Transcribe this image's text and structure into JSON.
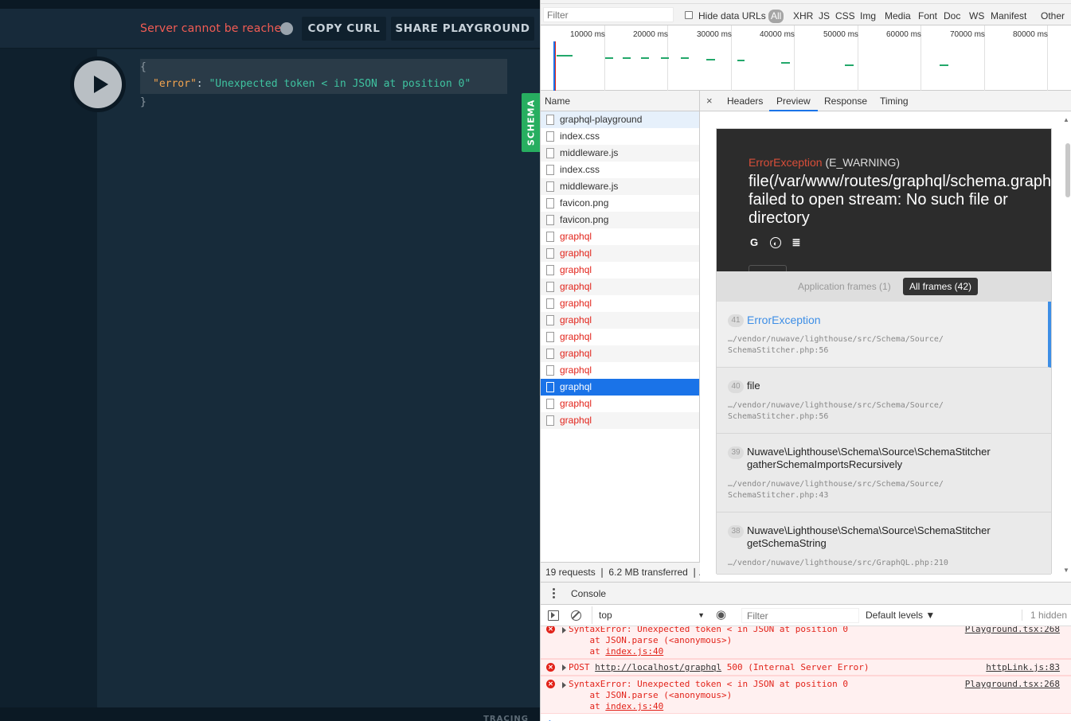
{
  "playground": {
    "status_text": "Server cannot be reached",
    "copy_curl": "COPY CURL",
    "share_playground": "SHARE PLAYGROUND",
    "schema_tab": "SCHEMA",
    "tracing": "TRACING",
    "result": {
      "open_brace": "{",
      "key": "\"error\"",
      "colon": ": ",
      "value": "\"Unexpected token < in JSON at position 0\"",
      "close_brace": "}"
    }
  },
  "network": {
    "filter_placeholder": "Filter",
    "hide_data_urls": "Hide data URLs",
    "filter_types": [
      "All",
      "XHR",
      "JS",
      "CSS",
      "Img",
      "Media",
      "Font",
      "Doc",
      "WS",
      "Manifest",
      "Other"
    ],
    "timeline_labels": [
      "10000 ms",
      "20000 ms",
      "30000 ms",
      "40000 ms",
      "50000 ms",
      "60000 ms",
      "70000 ms",
      "80000 ms"
    ],
    "name_header": "Name",
    "requests": [
      {
        "name": "graphql-playground",
        "state": "highlight"
      },
      {
        "name": "index.css",
        "state": "normal"
      },
      {
        "name": "middleware.js",
        "state": "normal"
      },
      {
        "name": "index.css",
        "state": "normal"
      },
      {
        "name": "middleware.js",
        "state": "normal"
      },
      {
        "name": "favicon.png",
        "state": "normal"
      },
      {
        "name": "favicon.png",
        "state": "normal"
      },
      {
        "name": "graphql",
        "state": "error"
      },
      {
        "name": "graphql",
        "state": "error"
      },
      {
        "name": "graphql",
        "state": "error"
      },
      {
        "name": "graphql",
        "state": "error"
      },
      {
        "name": "graphql",
        "state": "error"
      },
      {
        "name": "graphql",
        "state": "error"
      },
      {
        "name": "graphql",
        "state": "error"
      },
      {
        "name": "graphql",
        "state": "error"
      },
      {
        "name": "graphql",
        "state": "error"
      },
      {
        "name": "graphql",
        "state": "selected"
      },
      {
        "name": "graphql",
        "state": "error"
      },
      {
        "name": "graphql",
        "state": "error"
      }
    ],
    "status_bar": "19 requests  ❘  6.2 MB transferred  ❘..."
  },
  "detail": {
    "close": "×",
    "tabs": [
      "Headers",
      "Preview",
      "Response",
      "Timing"
    ],
    "active_tab": "Preview",
    "error_page": {
      "exception": "ErrorException",
      "level": " (E_WARNING)",
      "message": "file(/var/www/routes/graphql/schema.graphql): failed to open stream: No such file or directory",
      "icons": [
        "google-icon",
        "duckduckgo-icon",
        "stackoverflow-icon"
      ],
      "application_frames": "Application frames (1)",
      "all_frames": "All frames (42)",
      "frames": [
        {
          "num": "41",
          "name": "ErrorException",
          "path": "…/vendor/nuwave/lighthouse/src/Schema/Source/\nSchemaStitcher.php:56"
        },
        {
          "num": "40",
          "name": "file",
          "path": "…/vendor/nuwave/lighthouse/src/Schema/Source/\nSchemaStitcher.php:56"
        },
        {
          "num": "39",
          "name": "Nuwave\\Lighthouse\\Schema\\Source\\SchemaStitcher\ngatherSchemaImportsRecursively",
          "path": "…/vendor/nuwave/lighthouse/src/Schema/Source/\nSchemaStitcher.php:43"
        },
        {
          "num": "38",
          "name": "Nuwave\\Lighthouse\\Schema\\Source\\SchemaStitcher\ngetSchemaString",
          "path": "…/vendor/nuwave/lighthouse/src/GraphQL.php:210"
        }
      ]
    }
  },
  "console": {
    "tab": "Console",
    "context": "top",
    "filter_placeholder": "Filter",
    "levels": "Default levels ▼",
    "hidden": "1 hidden",
    "messages": [
      {
        "line1": "SyntaxError: Unexpected token < in JSON at position 0",
        "line2": "    at JSON.parse (<anonymous>)",
        "line3_prefix": "    at ",
        "line3_link": "index.js:40",
        "source": "Playground.tsx:268"
      },
      {
        "line1_prefix": "POST ",
        "line1_link": "http://localhost/graphql",
        "line1_suffix": " 500 (Internal Server Error)",
        "source": "httpLink.js:83"
      },
      {
        "line1": "SyntaxError: Unexpected token < in JSON at position 0",
        "line2": "    at JSON.parse (<anonymous>)",
        "line3_prefix": "    at ",
        "line3_link": "index.js:40",
        "source": "Playground.tsx:268"
      }
    ],
    "prompt": "›"
  },
  "colors": {
    "error_red": "#e2231a",
    "selection_blue": "#1a73e8",
    "schema_green": "#27ae60",
    "ignition_blue": "#3d8ee6"
  }
}
